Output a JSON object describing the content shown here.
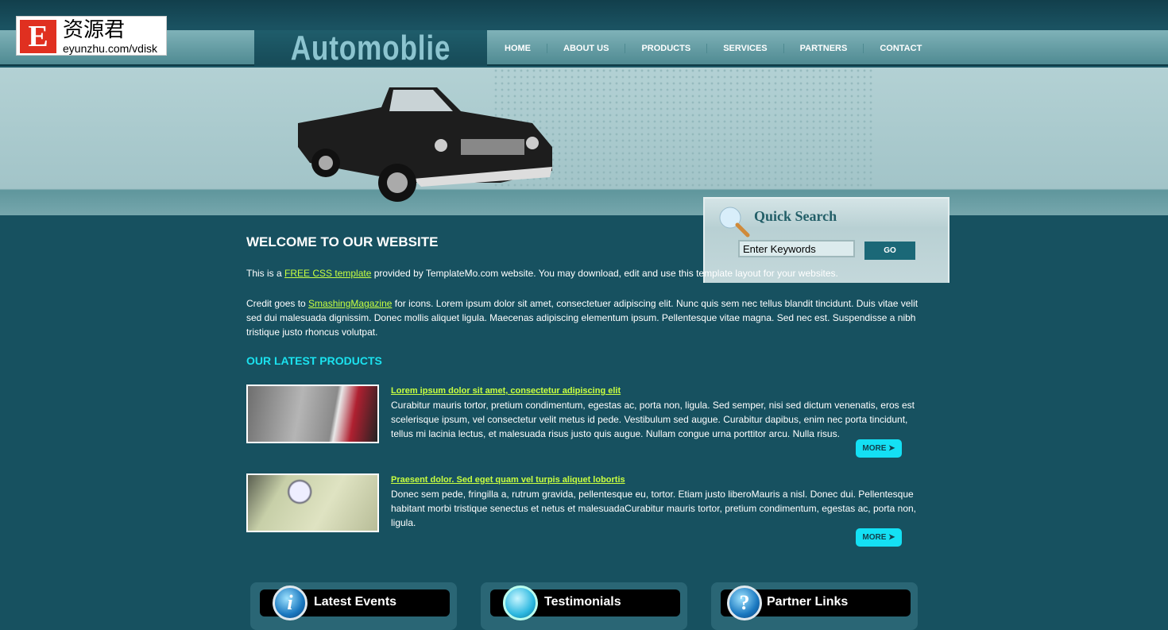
{
  "watermark": {
    "letter": "E",
    "chinese": "资源君",
    "url": "eyunzhu.com/vdisk"
  },
  "header": {
    "site_title": "Automoblie"
  },
  "nav": [
    "HOME",
    "ABOUT US",
    "PRODUCTS",
    "SERVICES",
    "PARTNERS",
    "CONTACT"
  ],
  "search": {
    "title": "Quick Search",
    "value": "Enter Keywords",
    "button": "GO"
  },
  "welcome": {
    "title": "WELCOME TO OUR WEBSITE",
    "p1_pre": "This is a ",
    "p1_link": "FREE CSS template",
    "p1_post": " provided by TemplateMo.com website. You may download, edit and use this template layout for your websites.",
    "p2_pre": "Credit goes to ",
    "p2_link": "SmashingMagazine",
    "p2_post": " for icons. Lorem ipsum dolor sit amet, consectetuer adipiscing elit. Nunc quis sem nec tellus blandit tincidunt. Duis vitae velit sed dui malesuada dignissim. Donec mollis aliquet ligula. Maecenas adipiscing elementum ipsum. Pellentesque vitae magna. Sed nec est. Suspendisse a nibh tristique justo rhoncus volutpat."
  },
  "products": {
    "title": "OUR LATEST PRODUCTS",
    "items": [
      {
        "title": "Lorem ipsum dolor sit amet, consectetur adipiscing elit",
        "text": "Curabitur mauris tortor, pretium condimentum, egestas ac, porta non, ligula. Sed semper, nisi sed dictum venenatis, eros est scelerisque ipsum, vel consectetur velit metus id pede. Vestibulum sed augue. Curabitur dapibus, enim nec porta tincidunt, tellus mi lacinia lectus, et malesuada risus justo quis augue. Nullam congue urna porttitor arcu. Nulla risus.",
        "more": "MORE ➤"
      },
      {
        "title": "Praesent dolor. Sed eget quam vel turpis aliquet lobortis",
        "text": "Donec sem pede, fringilla a, rutrum gravida, pellentesque eu, tortor. Etiam justo liberoMauris a nisl. Donec dui. Pellentesque habitant morbi tristique senectus et netus et malesuadaCurabitur mauris tortor, pretium condimentum, egestas ac, porta non, ligula.",
        "more": "MORE ➤"
      }
    ]
  },
  "boxes": [
    {
      "title": "Latest Events",
      "icon": "info-icon",
      "glyph": "i"
    },
    {
      "title": "Testimonials",
      "icon": "speech-bubble-icon",
      "glyph": ""
    },
    {
      "title": "Partner Links",
      "icon": "question-icon",
      "glyph": "?"
    }
  ]
}
